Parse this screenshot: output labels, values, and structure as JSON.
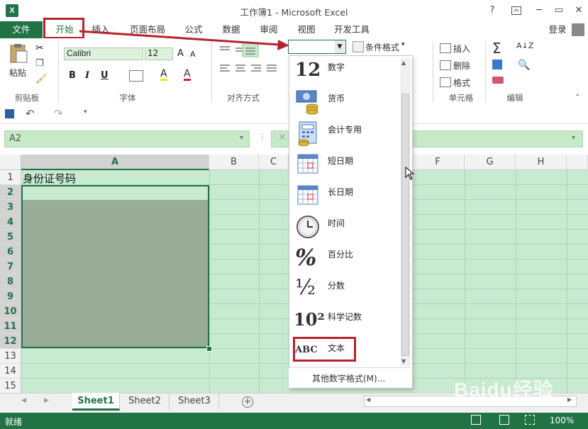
{
  "window": {
    "title": "工作簿1 - Microsoft Excel",
    "app_icon": "X",
    "help": "?",
    "min": "─",
    "restore": "▭",
    "close": "✕"
  },
  "tabs": {
    "file": "文件",
    "home": "开始",
    "insert": "插入",
    "page_layout": "页面布局",
    "formulas": "公式",
    "data": "数据",
    "review": "审阅",
    "view": "视图",
    "developer": "开发工具",
    "login": "登录"
  },
  "ribbon": {
    "clipboard": {
      "paste": "粘贴",
      "label": "剪贴板"
    },
    "font": {
      "name": "Calibri",
      "size": "12",
      "label": "字体",
      "bold": "B",
      "italic": "I",
      "underline": "U",
      "grow": "A",
      "shrink": "A",
      "font_color": "A",
      "fill": "A"
    },
    "align": {
      "label": "对齐方式"
    },
    "number": {
      "format_value": ""
    },
    "styles": {
      "conditional": "条件格式",
      "conditional_arrow": "▾"
    },
    "cells": {
      "insert": "插入",
      "delete": "删除",
      "format": "格式",
      "label": "单元格"
    },
    "edit": {
      "label": "编辑",
      "sum": "Σ"
    }
  },
  "name_box": {
    "value": "A2"
  },
  "columns": [
    "A",
    "B",
    "C",
    "F",
    "G",
    "H"
  ],
  "rows": [
    "1",
    "2",
    "3",
    "4",
    "5",
    "6",
    "7",
    "8",
    "9",
    "10",
    "11",
    "12",
    "13",
    "14",
    "15"
  ],
  "cells": {
    "A1": "身份证号码"
  },
  "dropdown": {
    "items": [
      {
        "label": "数字",
        "icon": "12"
      },
      {
        "label": "货币",
        "icon": "currency-icon"
      },
      {
        "label": "会计专用",
        "icon": "accounting-icon"
      },
      {
        "label": "短日期",
        "icon": "calendar-icon"
      },
      {
        "label": "长日期",
        "icon": "calendar-icon"
      },
      {
        "label": "时间",
        "icon": "clock-icon"
      },
      {
        "label": "百分比",
        "icon": "%"
      },
      {
        "label": "分数",
        "icon": "½"
      },
      {
        "label": "科学记数",
        "icon": "10²"
      },
      {
        "label": "文本",
        "icon": "ABC"
      }
    ],
    "more": "其他数字格式(M)..."
  },
  "sheets": [
    "Sheet1",
    "Sheet2",
    "Sheet3"
  ],
  "add_sheet": "+",
  "status": {
    "ready": "就绪",
    "zoom": "100%"
  },
  "watermark": "Baidu经验",
  "colors": {
    "excel_green": "#217346",
    "highlight_red": "#b5232d",
    "selection_fill": "#c7ead0"
  }
}
